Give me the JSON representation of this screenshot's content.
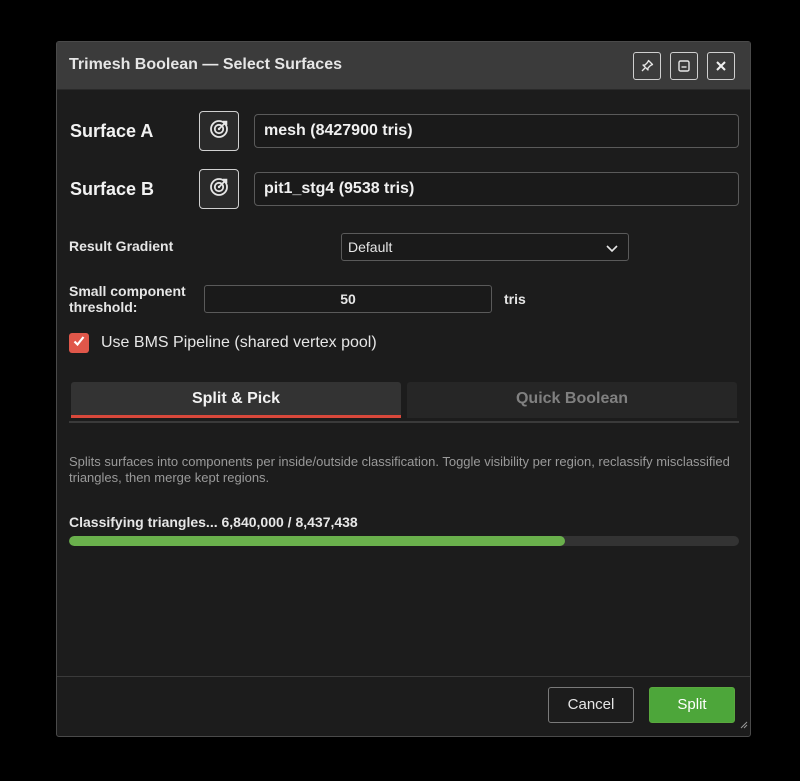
{
  "window": {
    "title": "Trimesh Boolean — Select Surfaces"
  },
  "titlebar_buttons": [
    {
      "icon": "pin-icon"
    },
    {
      "icon": "window-icon"
    },
    {
      "icon": "close-icon"
    }
  ],
  "surface_a": {
    "label": "Surface A",
    "value": "mesh (8427900 tris)",
    "pick_icon": "pick-target-icon"
  },
  "surface_b": {
    "label": "Surface B",
    "value": "pit1_stg4 (9538 tris)",
    "pick_icon": "pick-target-icon"
  },
  "result_gradient": {
    "label": "Result Gradient",
    "selected": "Default"
  },
  "threshold": {
    "label_line1": "Small component",
    "label_line2": "threshold:",
    "value": "50",
    "unit": "tris"
  },
  "bms": {
    "label": "Use BMS Pipeline (shared vertex pool)",
    "checked": true
  },
  "tabs": [
    {
      "label": "Split & Pick",
      "active": true
    },
    {
      "label": "Quick Boolean",
      "active": false
    }
  ],
  "description": "Splits surfaces into components per inside/outside classification. Toggle visibility per region, reclassify misclassified triangles, then merge kept regions.",
  "progress": {
    "label": "Classifying triangles... 6,840,000 / 8,437,438",
    "fraction": 0.74
  },
  "buttons": {
    "cancel": "Cancel",
    "split": "Split"
  },
  "colors": {
    "accent": "#d9483b",
    "checkbox": "#e0574a",
    "progress": "#6ab04c",
    "primary_button": "#4da63a"
  }
}
